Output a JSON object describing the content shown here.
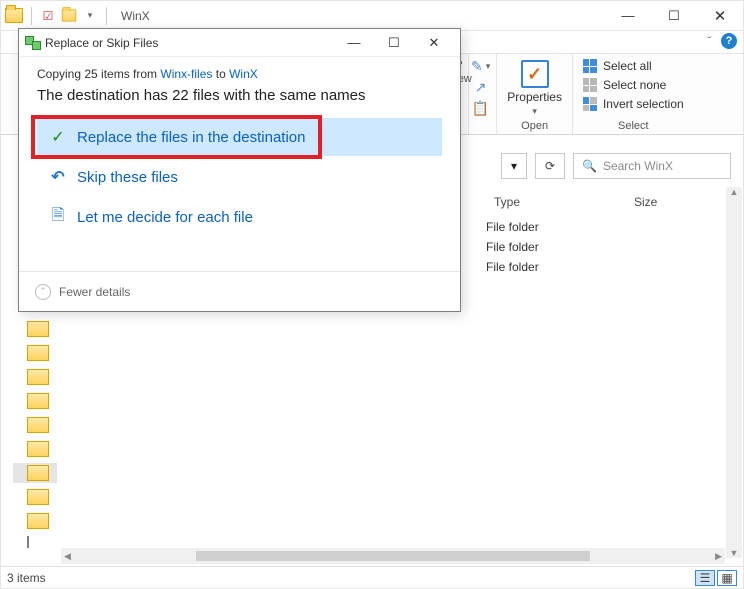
{
  "window": {
    "title": "WinX",
    "min": "—",
    "max": "☐",
    "close": "✕"
  },
  "ribbon": {
    "partial_left": "P\niew",
    "mini_icons": {
      "a": "✎",
      "b": "↗",
      "c": "📋"
    },
    "open": {
      "properties": "Properties",
      "check": "✓",
      "dropdown": "▾",
      "group": "Open"
    },
    "select": {
      "all": "Select all",
      "none": "Select none",
      "invert": "Invert selection",
      "group": "Select"
    }
  },
  "nav": {
    "chev": "▾",
    "refresh": "⟳",
    "search_icon": "🔍",
    "search_placeholder": "Search WinX"
  },
  "columns": {
    "type": "Type",
    "size": "Size"
  },
  "rows": [
    "File folder",
    "File folder",
    "File folder"
  ],
  "status": {
    "items": "3 items"
  },
  "dialog": {
    "title": "Replace or Skip Files",
    "min": "—",
    "max": "☐",
    "close": "✕",
    "copying_pre": "Copying 25 items from ",
    "copying_src": "Winx-files",
    "copying_mid": " to ",
    "copying_dst": "WinX",
    "dest_msg": "The destination has 22 files with the same names",
    "replace_icon": "✓",
    "replace": "Replace the files in the destination",
    "skip_icon": "↶",
    "skip": "Skip these files",
    "decide_icon": "🗎",
    "decide": "Let me decide for each file",
    "fewer_chev": "⌃",
    "fewer": "Fewer details"
  }
}
